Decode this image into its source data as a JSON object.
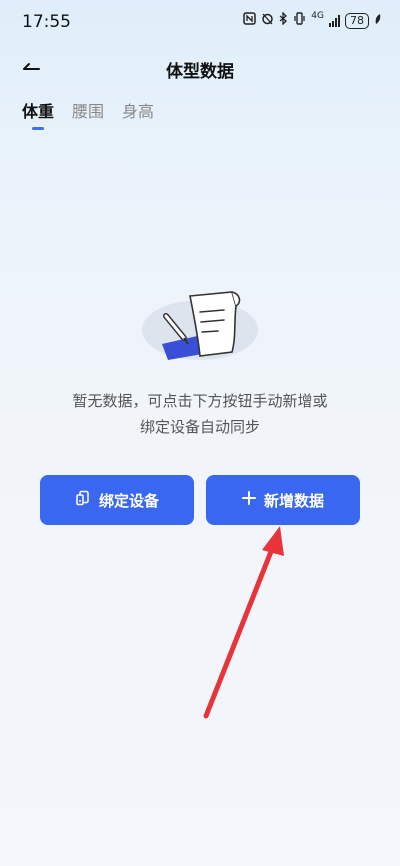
{
  "status_bar": {
    "time": "17:55",
    "network": "4G",
    "battery": "78"
  },
  "header": {
    "title": "体型数据"
  },
  "tabs": [
    {
      "label": "体重",
      "active": true
    },
    {
      "label": "腰围",
      "active": false
    },
    {
      "label": "身高",
      "active": false
    }
  ],
  "empty_state": {
    "line1": "暂无数据，可点击下方按钮手动新增或",
    "line2": "绑定设备自动同步"
  },
  "actions": {
    "bind_label": "绑定设备",
    "add_label": "新增数据"
  },
  "colors": {
    "accent": "#3a67f0",
    "annotation_arrow": "#e8333a"
  }
}
